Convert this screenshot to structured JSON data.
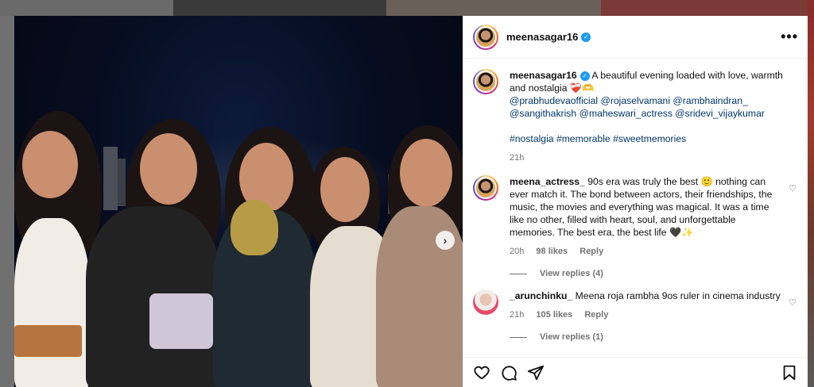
{
  "post": {
    "username": "meenasagar16",
    "more_label": "•••",
    "caption_text": "A beautiful evening loaded with love, warmth and nostalgia ❤️‍🩹🫶",
    "mentions_line1": "@prabhudevaofficial @rojaselvamani @rambhaindran_",
    "mentions_line2": "@sangithakrish @maheswari_actress @sridevi_vijaykumar",
    "hashtags": "#nostalgia #memorable #sweetmemories",
    "time": "21h"
  },
  "comments": [
    {
      "username": "meena_actress_",
      "text": "90s era was truly the best 🙂 nothing can ever match it. The bond between actors, their friendships, the music, the movies and everything was magical. It was a time like no other, filled with heart, soul, and unforgettable memories. The best era, the best life 🖤✨",
      "time": "20h",
      "likes": "98 likes",
      "reply": "Reply",
      "view_replies": "View replies (4)"
    },
    {
      "username": "_arunchinku_",
      "text": "Meena roja rambha 9os ruler in cinema industry",
      "time": "21h",
      "likes": "105 likes",
      "reply": "Reply",
      "view_replies": "View replies (1)"
    }
  ],
  "icons": {
    "like": "heart-icon",
    "comment": "comment-icon",
    "share": "share-icon",
    "save": "bookmark-icon",
    "next": "chevron-right-icon"
  },
  "photo": {
    "next_glyph": "›"
  },
  "colors": {
    "accent": "#1d9bf0",
    "link": "#00376b",
    "muted": "#737373"
  }
}
